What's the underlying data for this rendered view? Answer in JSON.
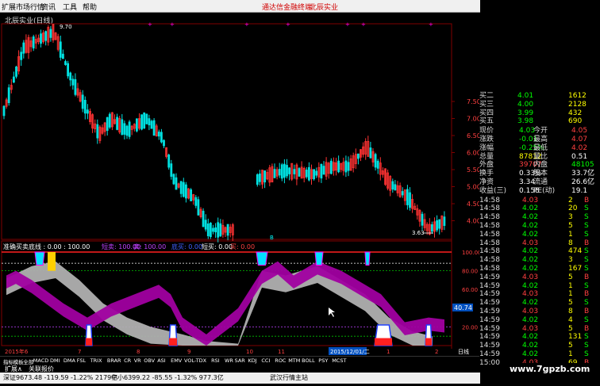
{
  "menu": {
    "app": "扩展市场行情",
    "items": [
      "资讯",
      "工具",
      "帮助"
    ],
    "ad": "通达信金融终端",
    "stock": "北辰实业"
  },
  "chart": {
    "title": "北辰实业(日线)",
    "high_label": "9.70",
    "low_label": "3.63",
    "right_axis": [
      "7.50",
      "7.00",
      "6.50",
      "6.00",
      "5.50",
      "5.00",
      "4.50",
      "4.00"
    ],
    "marker": "B"
  },
  "indicator": {
    "name": "准确买卖底线 : 0.00 : 100.00",
    "l1": "短卖: 100.00",
    "l2": "卖: 100.00",
    "l3": "底买: 0.00",
    "l4": "短买: 0.00",
    "l5": "买: 0.00",
    "axis": [
      "100.00",
      "80.00",
      "60.00",
      "40.74",
      "20.00"
    ]
  },
  "xaxis": {
    "labels": [
      "2015年6",
      "7",
      "8",
      "9",
      "10",
      "11",
      "2015/12/01/二",
      "1",
      "2"
    ],
    "cycle": "日线"
  },
  "quote": {
    "book": [
      {
        "k": "买二",
        "p": "4.01",
        "v": "1612"
      },
      {
        "k": "买三",
        "p": "4.00",
        "v": "2128"
      },
      {
        "k": "买四",
        "p": "3.99",
        "v": "432"
      },
      {
        "k": "买五",
        "p": "3.98",
        "v": "690"
      }
    ],
    "stats": [
      {
        "k": "现价",
        "v": "4.03",
        "k2": "今开",
        "v2": "4.05"
      },
      {
        "k": "涨跌",
        "v": "-0.01",
        "k2": "最高",
        "v2": "4.07"
      },
      {
        "k": "涨幅",
        "v": "-0.25%",
        "k2": "最低",
        "v2": "4.02"
      },
      {
        "k": "总量",
        "v": "87812",
        "k2": "量比",
        "v2": "0.51"
      },
      {
        "k": "外盘",
        "v": "39707",
        "k2": "内盘",
        "v2": "48105"
      },
      {
        "k": "换手",
        "v": "0.33%",
        "k2": "股本",
        "v2": "33.7亿"
      },
      {
        "k": "净资",
        "v": "3.34",
        "k2": "流通",
        "v2": "26.6亿"
      },
      {
        "k": "收益(三)",
        "v": "0.158",
        "k2": "PE(动)",
        "v2": "19.1"
      }
    ],
    "ticks": [
      {
        "t": "14:58",
        "p": "4.03",
        "v": "2",
        "s": "B"
      },
      {
        "t": "14:58",
        "p": "4.02",
        "v": "20",
        "s": "S"
      },
      {
        "t": "14:58",
        "p": "4.02",
        "v": "3",
        "s": "S"
      },
      {
        "t": "14:58",
        "p": "4.02",
        "v": "5",
        "s": "S"
      },
      {
        "t": "14:58",
        "p": "4.02",
        "v": "1",
        "s": "S"
      },
      {
        "t": "14:58",
        "p": "4.03",
        "v": "8",
        "s": "B"
      },
      {
        "t": "14:58",
        "p": "4.02",
        "v": "474",
        "s": "S"
      },
      {
        "t": "14:58",
        "p": "4.02",
        "v": "3",
        "s": "S"
      },
      {
        "t": "14:58",
        "p": "4.02",
        "v": "167",
        "s": "S"
      },
      {
        "t": "14:59",
        "p": "4.03",
        "v": "5",
        "s": "B"
      },
      {
        "t": "14:59",
        "p": "4.02",
        "v": "1",
        "s": "S"
      },
      {
        "t": "14:59",
        "p": "4.03",
        "v": "1",
        "s": "B"
      },
      {
        "t": "14:59",
        "p": "4.02",
        "v": "5",
        "s": "S"
      },
      {
        "t": "14:59",
        "p": "4.03",
        "v": "8",
        "s": "B"
      },
      {
        "t": "14:59",
        "p": "4.02",
        "v": "4",
        "s": "S"
      },
      {
        "t": "14:59",
        "p": "4.03",
        "v": "5",
        "s": "B"
      },
      {
        "t": "14:59",
        "p": "4.02",
        "v": "131",
        "s": "S"
      },
      {
        "t": "14:59",
        "p": "4.02",
        "v": "5",
        "s": "S"
      },
      {
        "t": "14:59",
        "p": "4.02",
        "v": "1",
        "s": "S"
      },
      {
        "t": "15:00",
        "p": "4.03",
        "v": "69",
        "s": "B"
      }
    ]
  },
  "tabs": [
    "指标",
    "模板",
    "全部",
    "MACD",
    "DMI",
    "DMA",
    "FSL",
    "TRIX",
    "BRAR",
    "CR",
    "VR",
    "OBV",
    "ASI",
    "EMV",
    "VOL-TDX",
    "RSI",
    "WR",
    "SAR",
    "KDJ",
    "CCI",
    "ROC",
    "MTM",
    "BOLL",
    "PSY",
    "MCST"
  ],
  "tabs2": [
    "扩展∧",
    "关联报价"
  ],
  "status": {
    "i1": "深证9673.48 -119.59 -1.22% 2179亿",
    "i2": "中小6399.22 -85.55 -1.32% 977.3亿",
    "i3": "武汉行情主站"
  },
  "watermark": "www.7gpzb.com",
  "colors": {
    "up": "#ff3333",
    "down": "#00e0e0",
    "magenta": "#a000a0",
    "gray": "#b0b0b0"
  }
}
